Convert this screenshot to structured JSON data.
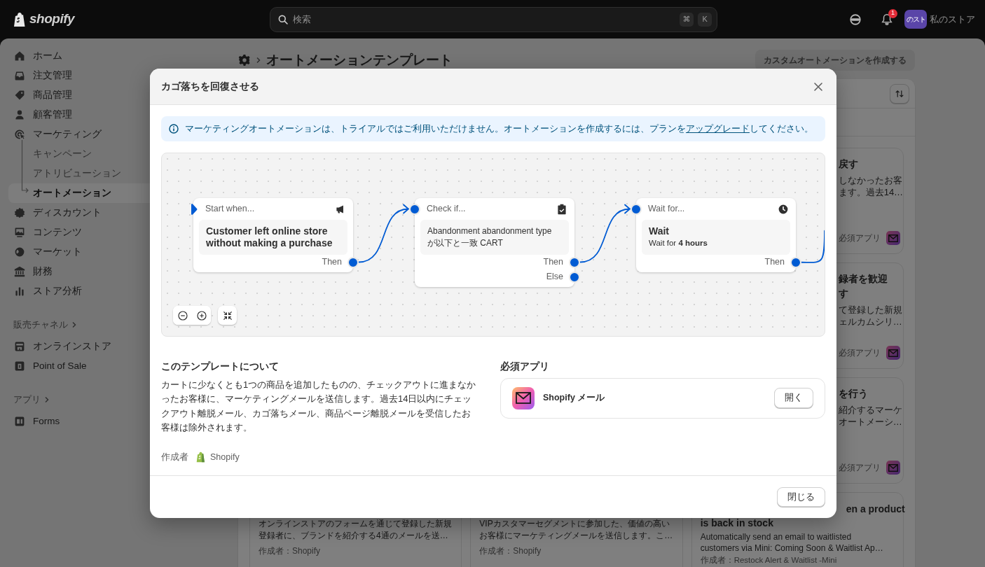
{
  "topbar": {
    "logo": "shopify",
    "search": {
      "placeholder": "検索",
      "shortcut_keys": [
        "⌘",
        "K"
      ]
    },
    "notification_count": "1",
    "store": {
      "avatar": "のスト",
      "name": "私のストア"
    }
  },
  "sidebar": {
    "groups": [
      {
        "items": [
          {
            "label": "ホーム",
            "selected": false
          },
          {
            "label": "注文管理",
            "selected": false
          },
          {
            "label": "商品管理",
            "selected": false
          },
          {
            "label": "顧客管理",
            "selected": false
          },
          {
            "label": "マーケティング",
            "selected": false,
            "children": [
              {
                "label": "キャンペーン",
                "selected": false
              },
              {
                "label": "アトリビューション",
                "selected": false
              },
              {
                "label": "オートメーション",
                "selected": true
              }
            ]
          },
          {
            "label": "ディスカウント",
            "selected": false
          },
          {
            "label": "コンテンツ",
            "selected": false
          },
          {
            "label": "マーケット",
            "selected": false
          },
          {
            "label": "財務",
            "selected": false
          },
          {
            "label": "ストア分析",
            "selected": false
          }
        ]
      },
      {
        "heading": "販売チャネル",
        "items": [
          {
            "label": "オンラインストア",
            "selected": false
          },
          {
            "label": "Point of Sale",
            "selected": false
          }
        ]
      },
      {
        "heading": "アプリ",
        "items": [
          {
            "label": "Forms",
            "selected": false
          }
        ]
      }
    ]
  },
  "page": {
    "title": "オートメーションテンプレート",
    "create_button": {
      "label": "カスタムオートメーションを作成する",
      "disabled": true
    }
  },
  "template_cards": [
    {
      "title": "戻す",
      "description": [
        "しなかったお客",
        "ます。過去14…"
      ],
      "required_label": "必須アプリ"
    },
    {
      "title": "録者を歓迎す",
      "description": [
        "て登録した新規",
        "ェルカムシリ…"
      ],
      "required_label": "必須アプリ"
    },
    {
      "title": "を行う",
      "description": [
        "紹介するマーケ",
        "オートメーシ…"
      ],
      "required_label": "必須アプリ"
    }
  ],
  "bottom_cards": [
    {
      "description": [
        "オンラインストアのフォームを通じて登録した新規",
        "登録者に、ブランドを紹介する4通のメールを送…"
      ],
      "author": "作成者：Shopify"
    },
    {
      "description": [
        "VIPカスタマーセグメントに参加した、価値の高い",
        "お客様にマーケティングメールを送信します。こ…"
      ],
      "author": "作成者：Shopify"
    },
    {
      "title": [
        "en a product",
        "is back in stock"
      ],
      "description": [
        "Automatically send an email to waitlisted",
        "customers via Mini: Coming Soon & Waitlist Ap…"
      ],
      "author": "作成者：Restock Alert & Waitlist -Mini"
    }
  ],
  "modal": {
    "title": "カゴ落ちを回復させる",
    "notice": {
      "text": "マーケティングオートメーションは、トライアルではご利用いただけません。オートメーションを作成するには、プランを",
      "link": "アップグレード",
      "text_after": "してください。"
    },
    "workflow": {
      "nodes": [
        {
          "kind": "trigger",
          "header": "Start when...",
          "title": "Customer left online store without making a purchase",
          "outputs": [
            "Then"
          ]
        },
        {
          "kind": "condition",
          "header": "Check if...",
          "body": "Abandonment abandonment type が以下と一致 CART",
          "outputs": [
            "Then",
            "Else"
          ]
        },
        {
          "kind": "action",
          "header": "Wait for...",
          "title": "Wait",
          "detail": "Wait for **4 hours**",
          "outputs": [
            "Then"
          ]
        }
      ]
    },
    "about": {
      "heading": "このテンプレートについて",
      "description": "カートに少なくとも1つの商品を追加したものの、チェックアウトに進まなかったお客様に、マーケティングメールを送信します。過去14日以内にチェックアウト離脱メール、カゴ落ちメール、商品ページ離脱メールを受信したお客様は除外されます。",
      "author_label": "作成者",
      "author": "Shopify"
    },
    "required_apps": {
      "heading": "必須アプリ",
      "apps": [
        {
          "name": "Shopify メール",
          "button": "開く"
        }
      ]
    },
    "close_button": "閉じる"
  }
}
